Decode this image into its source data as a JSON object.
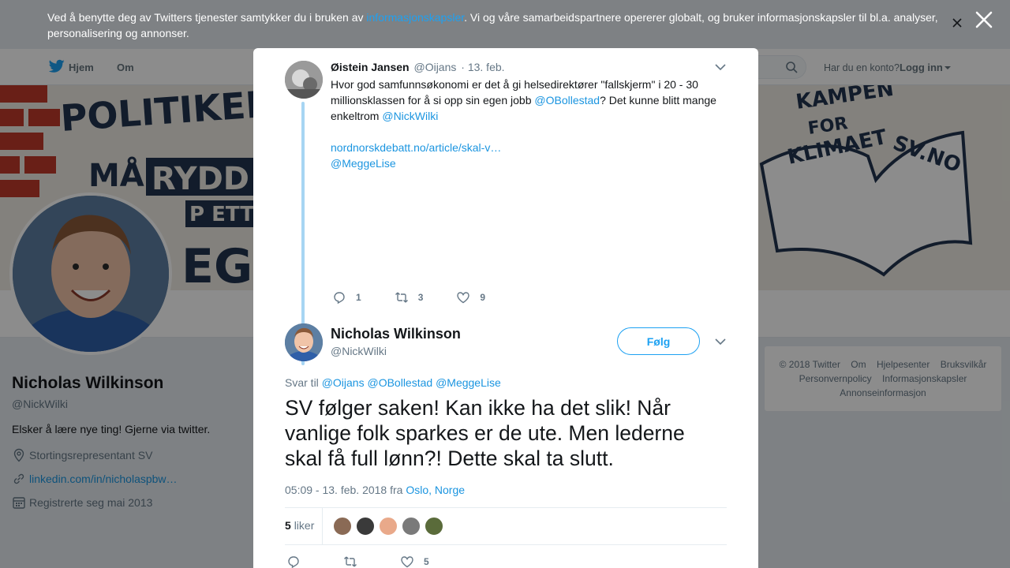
{
  "cookie_banner": {
    "text_before": "Ved å benytte deg av Twitters tjenester samtykker du i bruken av ",
    "link": "informasjonskapsler",
    "text_after": ". Vi og våre samarbeidspartnere opererer globalt, og bruker informasjonskapsler til bl.a. analyser, personalisering og annonser."
  },
  "nav": {
    "home": "Hjem",
    "about": "Om",
    "account_question": "Har du en konto?",
    "login": "Logg inn"
  },
  "profile": {
    "name": "Nicholas Wilkinson",
    "handle": "@NickWilki",
    "bio": "Elsker å lære nye ting! Gjerne via twitter.",
    "location": "Stortingsrepresentant SV",
    "url": "linkedin.com/in/nicholaspbw…",
    "joined": "Registrerte seg mai 2013"
  },
  "footer": {
    "copyright": "© 2018 Twitter",
    "about": "Om",
    "help": "Hjelpesenter",
    "terms": "Bruksvilkår",
    "privacy": "Personvernpolicy",
    "cookies": "Informasjonskapsler",
    "ads": "Annonseinformasjon"
  },
  "context_tweet": {
    "name": "Øistein Jansen",
    "handle": "@Oijans",
    "date": "· 13. feb.",
    "text_1": "Hvor god samfunnsøkonomi er det å gi helsedirektører \"fallskjerm\" i 20 - 30 millionsklassen for å si opp sin egen jobb ",
    "mention_1": "@OBollestad",
    "text_2": "? Det kunne blitt mange enkeltrom ",
    "mention_2": "@NickWilki",
    "link": "nordnorskdebatt.no/article/skal-v…",
    "mention_3": "@MeggeLise",
    "replies": "1",
    "retweets": "3",
    "likes": "9"
  },
  "main_tweet": {
    "name": "Nicholas Wilkinson",
    "handle": "@NickWilki",
    "follow_label": "Følg",
    "reply_to_label": "Svar til",
    "reply_to": [
      "@Oijans",
      "@OBollestad",
      "@MeggeLise"
    ],
    "text": "SV følger saken! Kan ikke ha det slik! Når vanlige folk sparkes er de ute. Men lederne skal få full lønn?! Dette skal ta slutt.",
    "time": "05:09 - 13. feb. 2018 fra ",
    "place": "Oslo, Norge",
    "likes_count": "5",
    "likes_label": "liker",
    "likers": [
      "#8a6a55",
      "#3a3a3a",
      "#e9a98a",
      "#7a7a7a",
      "#5a6b3a"
    ],
    "action_likes": "5"
  },
  "colors": {
    "accent": "#1da1f2",
    "link": "#1b95e0",
    "thread_line": "#a7d5f3"
  }
}
